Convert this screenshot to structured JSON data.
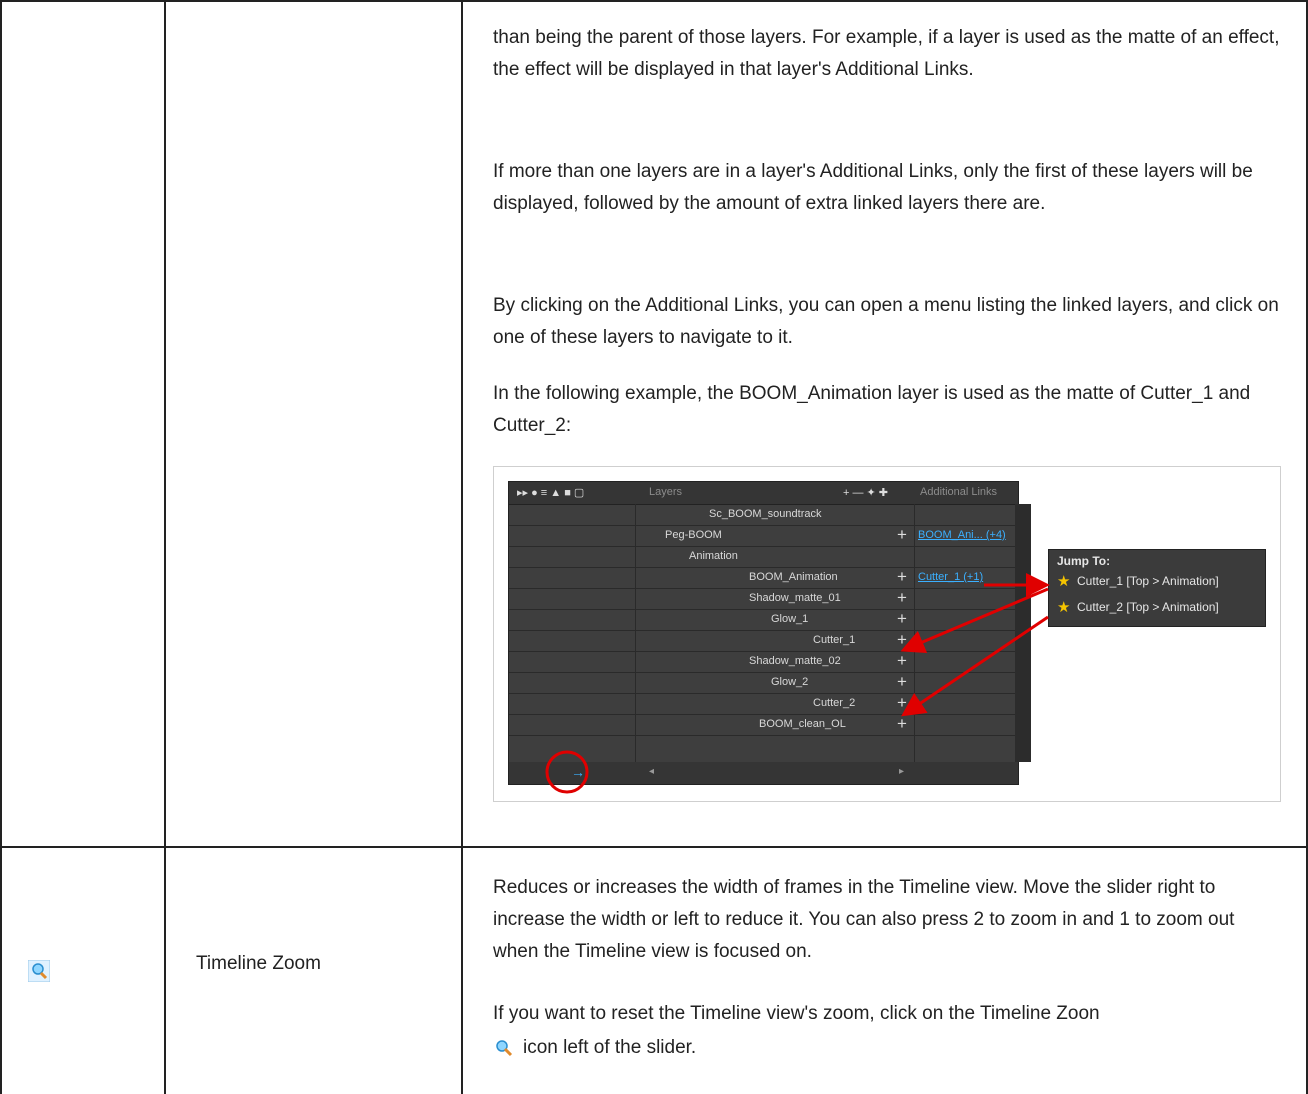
{
  "row1": {
    "paragraphs": [
      "than being the parent of those layers. For example, if a layer is used as the matte of an effect, the effect will be displayed in that layer's Additional Links.",
      "If more than one layers are in a layer's Additional Links, only the first of these layers will be displayed, followed by the amount of extra linked layers there are.",
      "By clicking on the Additional Links, you can open a menu listing the linked layers, and click on one of these layers to navigate to it.",
      "In the following example, the BOOM_Animation layer is used as the matte of Cutter_1 and Cutter_2:"
    ],
    "figure": {
      "header_layers": "Layers",
      "header_links": "Additional Links",
      "layers": [
        "Sc_BOOM_soundtrack",
        "Peg-BOOM",
        "Animation",
        "BOOM_Animation",
        "Shadow_matte_01",
        "Glow_1",
        "Cutter_1",
        "Shadow_matte_02",
        "Glow_2",
        "Cutter_2",
        "BOOM_clean_OL"
      ],
      "link_peg": "BOOM_Ani... (+4)",
      "link_boom": "Cutter_1 (+1)",
      "popup_title": "Jump To:",
      "popup_items": [
        "Cutter_1 [Top > Animation]",
        "Cutter_2 [Top > Animation]"
      ]
    }
  },
  "row2": {
    "name": "Timeline Zoom",
    "icon": "zoom-magnifier-icon",
    "paragraphs": [
      "Reduces or increases the width of frames in the Timeline view. Move the slider right to increase the width or left to reduce it. You can also press 2 to zoom in and 1 to zoom out when the Timeline view is focused on.",
      "If you want to reset the Timeline view's zoom, click on the Timeline Zoon"
    ],
    "tail": "icon left of the slider."
  }
}
